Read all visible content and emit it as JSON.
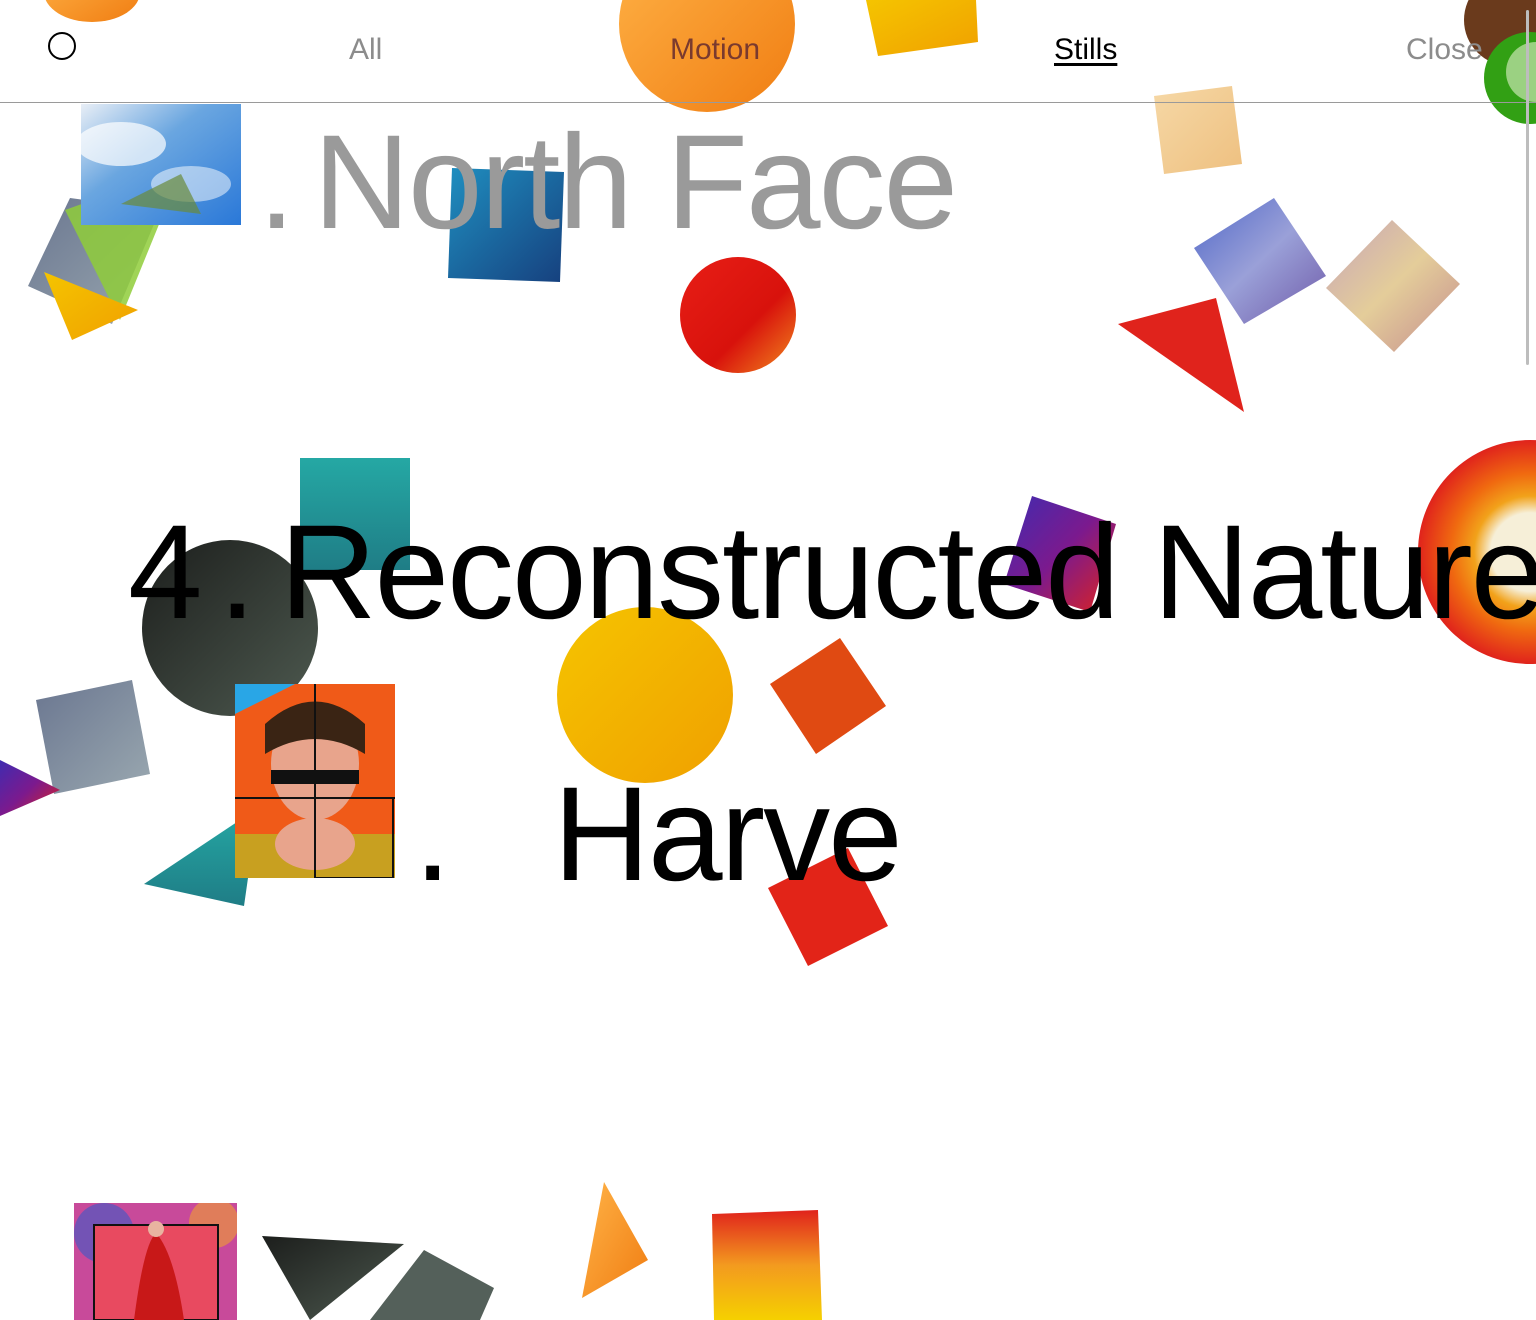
{
  "nav": {
    "logo_icon": "circle-logo-icon",
    "items": [
      {
        "label": "All",
        "active": false
      },
      {
        "label": "Motion",
        "active": false
      },
      {
        "label": "Stills",
        "active": true
      },
      {
        "label": "Close",
        "active": false
      }
    ]
  },
  "projects": [
    {
      "number": "",
      "dot": ".",
      "name": "North Face",
      "state": "dimmed"
    },
    {
      "number": "4",
      "dot": ".",
      "name": "Reconstructed Nature",
      "state": "focused"
    },
    {
      "number": "",
      "dot": ".",
      "name": "Harve",
      "state": "partially revealed"
    },
    {
      "number": "",
      "dot": "",
      "name": "",
      "state": "cut off"
    }
  ],
  "colors": {
    "accent_orange": "#f39a1f",
    "accent_red": "#e0231c",
    "accent_cyan": "#29c6e6",
    "nav_muted": "#8c8c8c",
    "nav_motion": "#7a3a2e"
  }
}
